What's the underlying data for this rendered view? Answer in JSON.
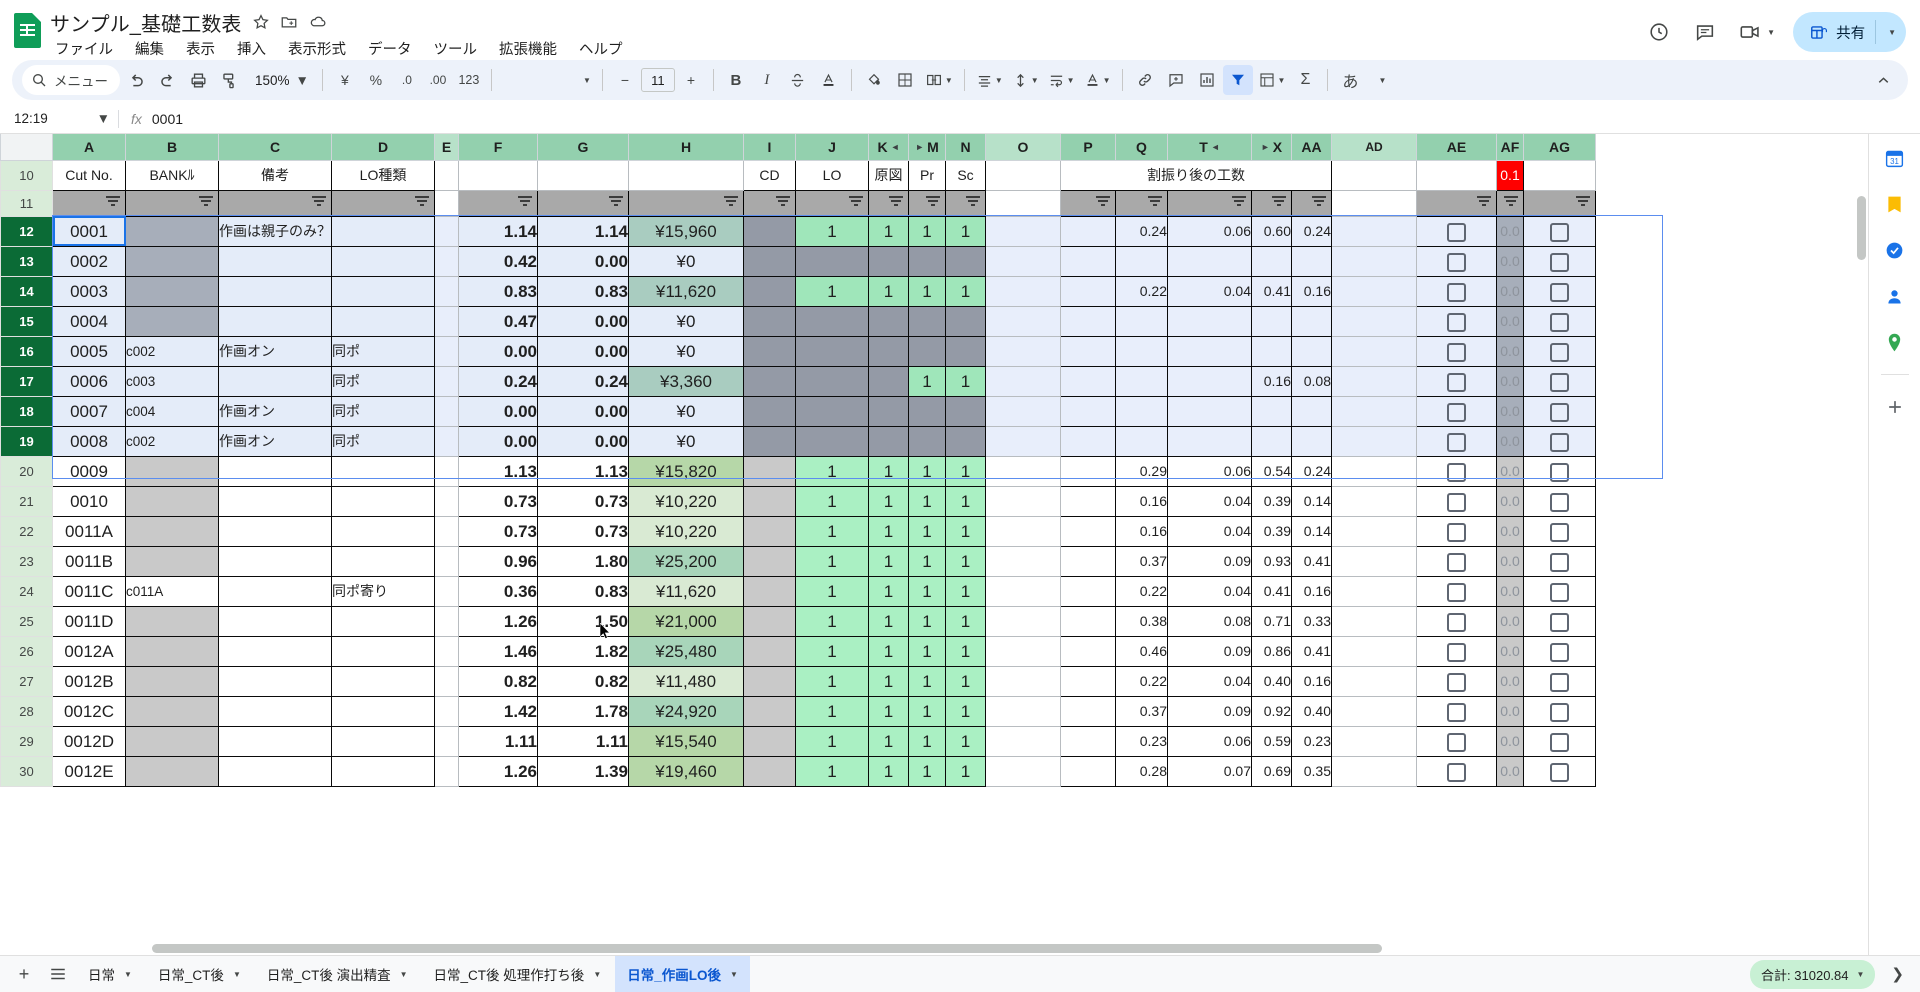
{
  "app": {
    "doc_title": "サンプル_基礎工数表",
    "logo": "google-sheets-logo"
  },
  "menubar": {
    "items": [
      "ファイル",
      "編集",
      "表示",
      "挿入",
      "表示形式",
      "データ",
      "ツール",
      "拡張機能",
      "ヘルプ"
    ]
  },
  "header_actions": {
    "history_icon": "version-history-icon",
    "comment_icon": "comment-icon",
    "meet_icon": "meet-video-icon",
    "share_label": "共有",
    "share_icon": "share-lock-icon"
  },
  "toolbar": {
    "search_label": "メニュー",
    "undo": "undo-icon",
    "redo": "redo-icon",
    "print": "print-icon",
    "paint": "paint-format-icon",
    "zoom_value": "150%",
    "currency": "¥",
    "percent": "%",
    "dec_decrease": ".0",
    "dec_increase": ".00",
    "more_formats": "123",
    "font_family": "",
    "font_minus": "−",
    "font_size": "11",
    "font_plus": "+",
    "bold": "B",
    "italic": "I",
    "strikethrough": "S",
    "text_color": "A",
    "fill_color": "fill-color-icon",
    "borders": "borders-icon",
    "merge": "merge-cells-icon",
    "halign": "horizontal-align-icon",
    "valign": "vertical-align-icon",
    "wrap": "text-wrap-icon",
    "rotate": "text-rotation-icon",
    "link": "insert-link-icon",
    "comment": "insert-comment-icon",
    "chart": "insert-chart-icon",
    "filter": "filter-icon",
    "functions_menu": "pivot-icon",
    "sum": "Σ",
    "ime": "あ",
    "collapse": "collapse-toolbar-icon"
  },
  "formulabar": {
    "namebox_value": "12:19",
    "fx_label": "fx",
    "formula_value": "0001"
  },
  "grid": {
    "columns": [
      "A",
      "B",
      "C",
      "D",
      "E",
      "F",
      "G",
      "H",
      "I",
      "J",
      "K",
      "M",
      "N",
      "O",
      "P",
      "Q",
      "T",
      "X",
      "AA",
      "AD",
      "AE",
      "AF",
      "AG"
    ],
    "selected_columns": [
      "A",
      "B",
      "C",
      "D",
      "F",
      "G",
      "H",
      "I",
      "J",
      "K",
      "M",
      "N",
      "P",
      "Q",
      "T",
      "X",
      "AA",
      "AE",
      "AF",
      "AG"
    ],
    "hidden_markers": [
      {
        "after": "K",
        "before": "M"
      },
      {
        "after": "T",
        "before": "X"
      },
      {
        "after": "AA",
        "before": "AD"
      }
    ],
    "header_row_number": "10",
    "filter_row_number": "11",
    "header_labels": {
      "A": "Cut No.",
      "B": "BANKﾙ",
      "C": "備考",
      "D": "LO種類",
      "I": "CD",
      "J": "LO",
      "K": "原図",
      "M": "Pr",
      "N": "Sc",
      "merged_PtoAA": "割振り後の工数",
      "AF": "0.1"
    },
    "selected_rows": [
      "12",
      "13",
      "14",
      "15",
      "16",
      "17",
      "18",
      "19"
    ],
    "cursor_cell": "A12",
    "rows": [
      {
        "n": "12",
        "A": "0001",
        "B": "",
        "C": "作画は親子のみ？",
        "D": "",
        "F": "1.14",
        "G": "1.14",
        "H": "¥15,960",
        "Hc": "c-tealsel",
        "I": "",
        "J": "1",
        "K": "1",
        "M": "1",
        "N": "1",
        "Q": "0.24",
        "T": "0.06",
        "X": "0.60",
        "AA": "0.24",
        "AF": "0.0"
      },
      {
        "n": "13",
        "A": "0002",
        "B": "",
        "C": "",
        "D": "",
        "F": "0.42",
        "G": "0.00",
        "H": "¥0",
        "Hc": "c-sel",
        "I": "",
        "J": "",
        "K": "",
        "M": "",
        "N": "",
        "Q": "",
        "T": "",
        "X": "",
        "AA": "",
        "AF": "0.0"
      },
      {
        "n": "14",
        "A": "0003",
        "B": "",
        "C": "",
        "D": "",
        "F": "0.83",
        "G": "0.83",
        "H": "¥11,620",
        "Hc": "c-tealsel",
        "I": "",
        "J": "1",
        "K": "1",
        "M": "1",
        "N": "1",
        "Q": "0.22",
        "T": "0.04",
        "X": "0.41",
        "AA": "0.16",
        "AF": "0.0"
      },
      {
        "n": "15",
        "A": "0004",
        "B": "",
        "C": "",
        "D": "",
        "F": "0.47",
        "G": "0.00",
        "H": "¥0",
        "Hc": "c-sel",
        "I": "",
        "J": "",
        "K": "",
        "M": "",
        "N": "",
        "Q": "",
        "T": "",
        "X": "",
        "AA": "",
        "AF": "0.0"
      },
      {
        "n": "16",
        "A": "0005",
        "B": "c002",
        "C": "作画オン",
        "D": "同ポ",
        "F": "0.00",
        "G": "0.00",
        "H": "¥0",
        "Hc": "c-sel",
        "I": "",
        "J": "",
        "K": "",
        "M": "",
        "N": "",
        "Q": "",
        "T": "",
        "X": "",
        "AA": "",
        "AF": "0.0"
      },
      {
        "n": "17",
        "A": "0006",
        "B": "c003",
        "C": "",
        "D": "同ポ",
        "F": "0.24",
        "G": "0.24",
        "H": "¥3,360",
        "Hc": "c-tealsel",
        "I": "",
        "J": "",
        "K": "",
        "M": "1",
        "N": "1",
        "Q": "",
        "T": "",
        "X": "0.16",
        "AA": "0.08",
        "AF": "0.0"
      },
      {
        "n": "18",
        "A": "0007",
        "B": "c004",
        "C": "作画オン",
        "D": "同ポ",
        "F": "0.00",
        "G": "0.00",
        "H": "¥0",
        "Hc": "c-sel",
        "I": "",
        "J": "",
        "K": "",
        "M": "",
        "N": "",
        "Q": "",
        "T": "",
        "X": "",
        "AA": "",
        "AF": "0.0"
      },
      {
        "n": "19",
        "A": "0008",
        "B": "c002",
        "C": "作画オン",
        "D": "同ポ",
        "F": "0.00",
        "G": "0.00",
        "H": "¥0",
        "Hc": "c-sel",
        "I": "",
        "J": "",
        "K": "",
        "M": "",
        "N": "",
        "Q": "",
        "T": "",
        "X": "",
        "AA": "",
        "AF": "0.0"
      },
      {
        "n": "20",
        "A": "0009",
        "B": "",
        "C": "",
        "D": "",
        "F": "1.13",
        "G": "1.13",
        "H": "¥15,820",
        "Hc": "c-green2",
        "I": "",
        "J": "1",
        "K": "1",
        "M": "1",
        "N": "1",
        "Q": "0.29",
        "T": "0.06",
        "X": "0.54",
        "AA": "0.24",
        "AF": "0.0"
      },
      {
        "n": "21",
        "A": "0010",
        "B": "",
        "C": "",
        "D": "",
        "F": "0.73",
        "G": "0.73",
        "H": "¥10,220",
        "Hc": "c-green1",
        "I": "",
        "J": "1",
        "K": "1",
        "M": "1",
        "N": "1",
        "Q": "0.16",
        "T": "0.04",
        "X": "0.39",
        "AA": "0.14",
        "AF": "0.0"
      },
      {
        "n": "22",
        "A": "0011A",
        "B": "",
        "C": "",
        "D": "",
        "F": "0.73",
        "G": "0.73",
        "H": "¥10,220",
        "Hc": "c-green1",
        "I": "",
        "J": "1",
        "K": "1",
        "M": "1",
        "N": "1",
        "Q": "0.16",
        "T": "0.04",
        "X": "0.39",
        "AA": "0.14",
        "AF": "0.0"
      },
      {
        "n": "23",
        "A": "0011B",
        "B": "",
        "C": "",
        "D": "",
        "F": "0.96",
        "G": "1.80",
        "H": "¥25,200",
        "Hc": "c-green3",
        "I": "",
        "J": "1",
        "K": "1",
        "M": "1",
        "N": "1",
        "Q": "0.37",
        "T": "0.09",
        "X": "0.93",
        "AA": "0.41",
        "AF": "0.0"
      },
      {
        "n": "24",
        "A": "0011C",
        "B": "c011A",
        "C": "",
        "D": "同ポ寄り",
        "F": "0.36",
        "G": "0.83",
        "H": "¥11,620",
        "Hc": "c-green1",
        "I": "",
        "J": "1",
        "K": "1",
        "M": "1",
        "N": "1",
        "Q": "0.22",
        "T": "0.04",
        "X": "0.41",
        "AA": "0.16",
        "AF": "0.0"
      },
      {
        "n": "25",
        "A": "0011D",
        "B": "",
        "C": "",
        "D": "",
        "F": "1.26",
        "G": "1.50",
        "H": "¥21,000",
        "Hc": "c-green2",
        "I": "",
        "J": "1",
        "K": "1",
        "M": "1",
        "N": "1",
        "Q": "0.38",
        "T": "0.08",
        "X": "0.71",
        "AA": "0.33",
        "AF": "0.0"
      },
      {
        "n": "26",
        "A": "0012A",
        "B": "",
        "C": "",
        "D": "",
        "F": "1.46",
        "G": "1.82",
        "H": "¥25,480",
        "Hc": "c-green3",
        "I": "",
        "J": "1",
        "K": "1",
        "M": "1",
        "N": "1",
        "Q": "0.46",
        "T": "0.09",
        "X": "0.86",
        "AA": "0.41",
        "AF": "0.0"
      },
      {
        "n": "27",
        "A": "0012B",
        "B": "",
        "C": "",
        "D": "",
        "F": "0.82",
        "G": "0.82",
        "H": "¥11,480",
        "Hc": "c-green1",
        "I": "",
        "J": "1",
        "K": "1",
        "M": "1",
        "N": "1",
        "Q": "0.22",
        "T": "0.04",
        "X": "0.40",
        "AA": "0.16",
        "AF": "0.0"
      },
      {
        "n": "28",
        "A": "0012C",
        "B": "",
        "C": "",
        "D": "",
        "F": "1.42",
        "G": "1.78",
        "H": "¥24,920",
        "Hc": "c-green3",
        "I": "",
        "J": "1",
        "K": "1",
        "M": "1",
        "N": "1",
        "Q": "0.37",
        "T": "0.09",
        "X": "0.92",
        "AA": "0.40",
        "AF": "0.0"
      },
      {
        "n": "29",
        "A": "0012D",
        "B": "",
        "C": "",
        "D": "",
        "F": "1.11",
        "G": "1.11",
        "H": "¥15,540",
        "Hc": "c-green2",
        "I": "",
        "J": "1",
        "K": "1",
        "M": "1",
        "N": "1",
        "Q": "0.23",
        "T": "0.06",
        "X": "0.59",
        "AA": "0.23",
        "AF": "0.0"
      },
      {
        "n": "30",
        "A": "0012E",
        "B": "",
        "C": "",
        "D": "",
        "F": "1.26",
        "G": "1.39",
        "H": "¥19,460",
        "Hc": "c-green2",
        "I": "",
        "J": "1",
        "K": "1",
        "M": "1",
        "N": "1",
        "Q": "0.28",
        "T": "0.07",
        "X": "0.69",
        "AA": "0.35",
        "AF": "0.0"
      }
    ]
  },
  "sidepanel": {
    "icons": [
      "calendar-icon",
      "keep-notes-icon",
      "tasks-icon",
      "contacts-icon",
      "maps-icon",
      "add-apps-icon"
    ]
  },
  "bottombar": {
    "add_sheet": "+",
    "all_sheets": "all-sheets-icon",
    "tabs": [
      {
        "label": "日常",
        "active": false
      },
      {
        "label": "日常_CT後",
        "active": false
      },
      {
        "label": "日常_CT後 演出精査",
        "active": false
      },
      {
        "label": "日常_CT後 処理作打ち後",
        "active": false
      },
      {
        "label": "日常_作画LO後",
        "active": true
      }
    ],
    "sum_label": "合計: 31020.84",
    "expand_icon": "expand-panel-icon"
  },
  "colors": {
    "brand_green": "#0f9d58",
    "share_blue": "#c2e7ff",
    "active_tab": "#d3e3fd",
    "header_green": "#b7e1c9",
    "selected_row_header": "#0b6b36",
    "alert_red": "#ff0000"
  }
}
